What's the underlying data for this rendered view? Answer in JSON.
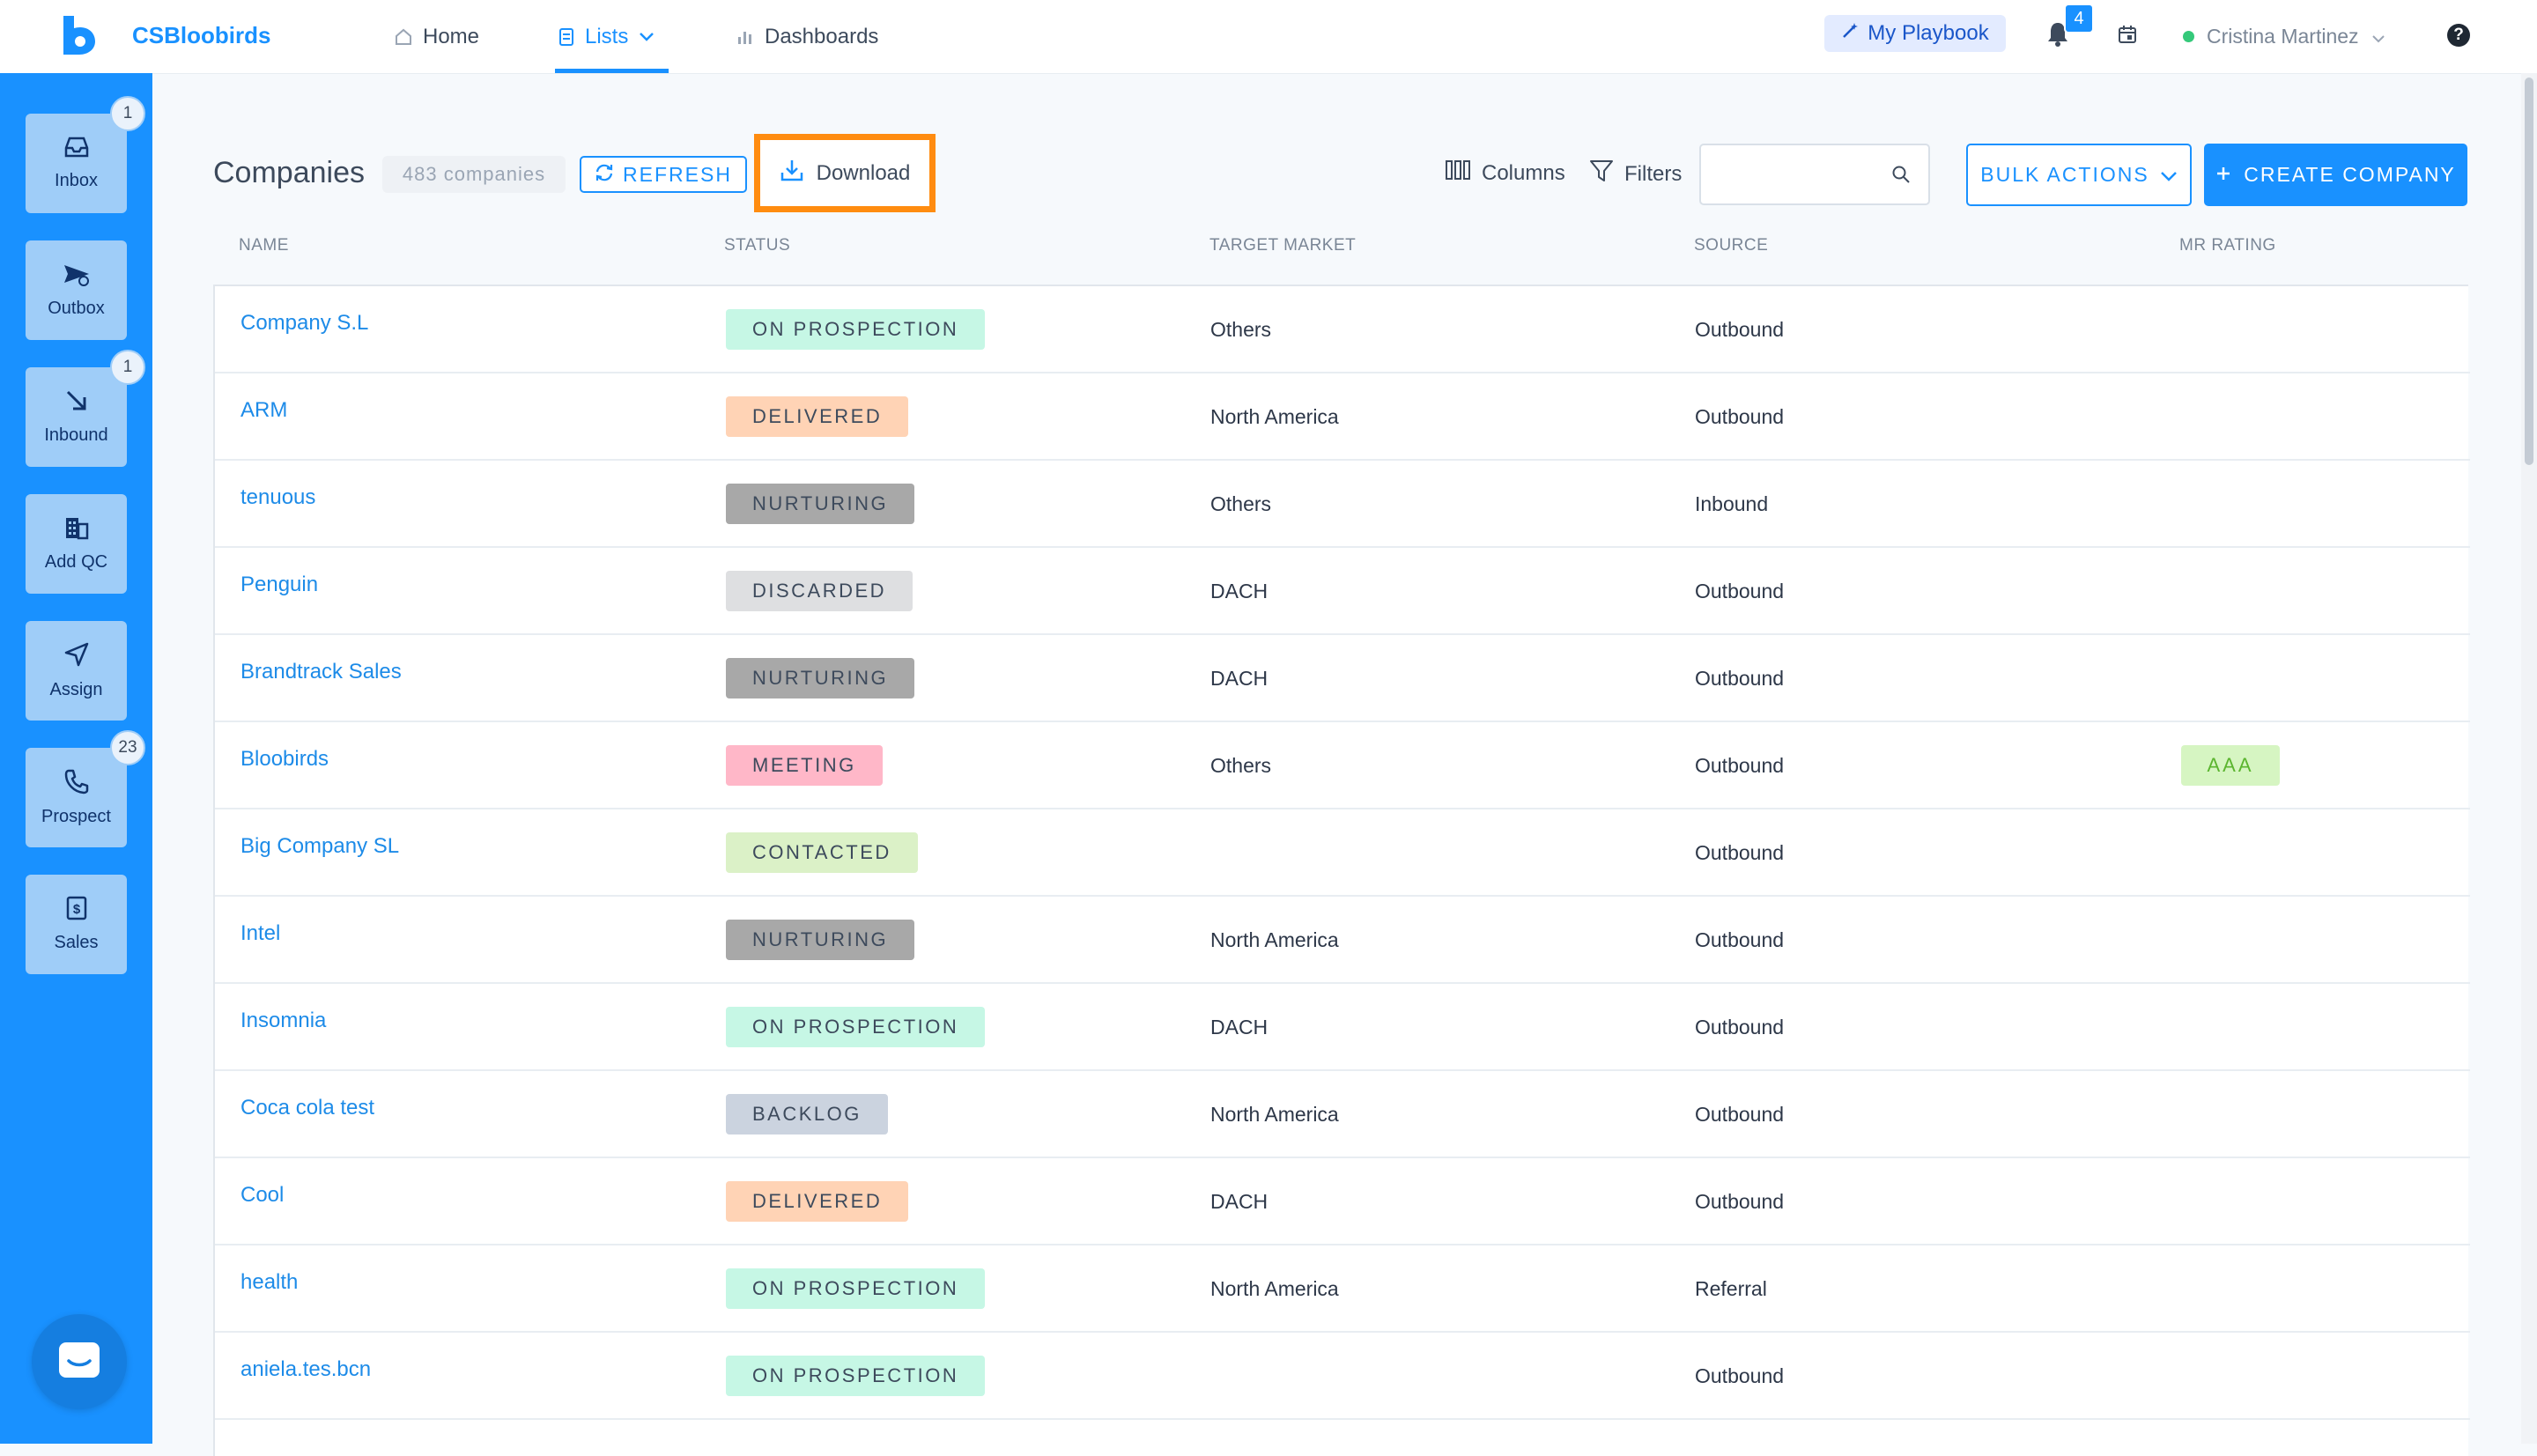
{
  "app": {
    "name": "CSBloobirds"
  },
  "nav": {
    "home": "Home",
    "lists": "Lists",
    "dashboards": "Dashboards",
    "playbook": "My Playbook",
    "notifications_count": "4",
    "user_name": "Cristina Martinez"
  },
  "sidebar": {
    "items": [
      {
        "label": "Inbox",
        "icon": "inbox-icon",
        "badge": "1"
      },
      {
        "label": "Outbox",
        "icon": "send-icon",
        "badge": ""
      },
      {
        "label": "Inbound",
        "icon": "arrow-down-right-icon",
        "badge": "1"
      },
      {
        "label": "Add QC",
        "icon": "building-icon",
        "badge": ""
      },
      {
        "label": "Assign",
        "icon": "navigation-icon",
        "badge": ""
      },
      {
        "label": "Prospect",
        "icon": "phone-icon",
        "badge": "23"
      },
      {
        "label": "Sales",
        "icon": "dollar-icon",
        "badge": ""
      }
    ]
  },
  "header": {
    "title": "Companies",
    "count": "483 companies",
    "refresh": "REFRESH",
    "download": "Download",
    "columns": "Columns",
    "filters": "Filters",
    "search_placeholder": "",
    "bulk_actions": "BULK ACTIONS",
    "create": "CREATE COMPANY"
  },
  "table": {
    "columns": [
      "NAME",
      "STATUS",
      "TARGET MARKET",
      "SOURCE",
      "MR RATING"
    ],
    "rows": [
      {
        "name": "Company S.L",
        "status": "ON PROSPECTION",
        "market": "Others",
        "source": "Outbound",
        "rating": ""
      },
      {
        "name": "ARM",
        "status": "DELIVERED",
        "market": "North America",
        "source": "Outbound",
        "rating": ""
      },
      {
        "name": "tenuous",
        "status": "NURTURING",
        "market": "Others",
        "source": "Inbound",
        "rating": ""
      },
      {
        "name": "Penguin",
        "status": "DISCARDED",
        "market": "DACH",
        "source": "Outbound",
        "rating": ""
      },
      {
        "name": "Brandtrack Sales",
        "status": "NURTURING",
        "market": "DACH",
        "source": "Outbound",
        "rating": ""
      },
      {
        "name": "Bloobirds",
        "status": "MEETING",
        "market": "Others",
        "source": "Outbound",
        "rating": "AAA"
      },
      {
        "name": "Big Company SL",
        "status": "CONTACTED",
        "market": "",
        "source": "Outbound",
        "rating": ""
      },
      {
        "name": "Intel",
        "status": "NURTURING",
        "market": "North America",
        "source": "Outbound",
        "rating": ""
      },
      {
        "name": "Insomnia",
        "status": "ON PROSPECTION",
        "market": "DACH",
        "source": "Outbound",
        "rating": ""
      },
      {
        "name": "Coca cola test",
        "status": "BACKLOG",
        "market": "North America",
        "source": "Outbound",
        "rating": ""
      },
      {
        "name": "Cool",
        "status": "DELIVERED",
        "market": "DACH",
        "source": "Outbound",
        "rating": ""
      },
      {
        "name": "health",
        "status": "ON PROSPECTION",
        "market": "North America",
        "source": "Referral",
        "rating": ""
      },
      {
        "name": "aniela.tes.bcn",
        "status": "ON PROSPECTION",
        "market": "",
        "source": "Outbound",
        "rating": ""
      }
    ]
  },
  "colors": {
    "brand": "#1991ff",
    "highlight": "#ff8c10",
    "status": {
      "ON PROSPECTION": "#c6f7e5",
      "DELIVERED": "#ffd3b5",
      "NURTURING": "#a8a8a8",
      "DISCARDED": "#dedfe1",
      "MEETING": "#ffb7c8",
      "CONTACTED": "#dbf1c7",
      "BACKLOG": "#cbd3df"
    }
  }
}
